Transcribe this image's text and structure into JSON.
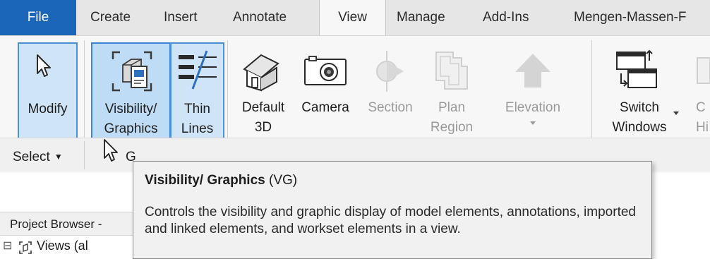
{
  "tabs": {
    "file": "File",
    "create": "Create",
    "insert": "Insert",
    "annotate": "Annotate",
    "view": "View",
    "manage": "Manage",
    "addins": "Add-Ins",
    "mengen": "Mengen-Massen-F"
  },
  "ribbon": {
    "modify": "Modify",
    "vg_line1": "Visibility/",
    "vg_line2": "Graphics",
    "thin_line1": "Thin",
    "thin_line2": "Lines",
    "default3d_line1": "Default",
    "default3d_line2": "3D",
    "camera": "Camera",
    "section": "Section",
    "plan_line1": "Plan",
    "plan_line2": "Region",
    "elevation": "Elevation",
    "switch_line1": "Switch",
    "switch_line2": "Windows",
    "partial_line1": "C",
    "partial_line2": "Hi",
    "select_label": "Select",
    "graphics_panel_partial": "G"
  },
  "tooltip": {
    "title": "Visibility/ Graphics",
    "shortcut": "(VG)",
    "body": "Controls the visibility and graphic display of model elements, annotations, imported and linked elements, and workset elements in a view."
  },
  "project_browser": {
    "header": "Project Browser -",
    "tree_expander": "⊟",
    "tree_item": "Views (al"
  },
  "colors": {
    "file_tab": "#1b66b9",
    "selected_button": "#cfe4f7",
    "selected_border": "#4a90d9"
  }
}
